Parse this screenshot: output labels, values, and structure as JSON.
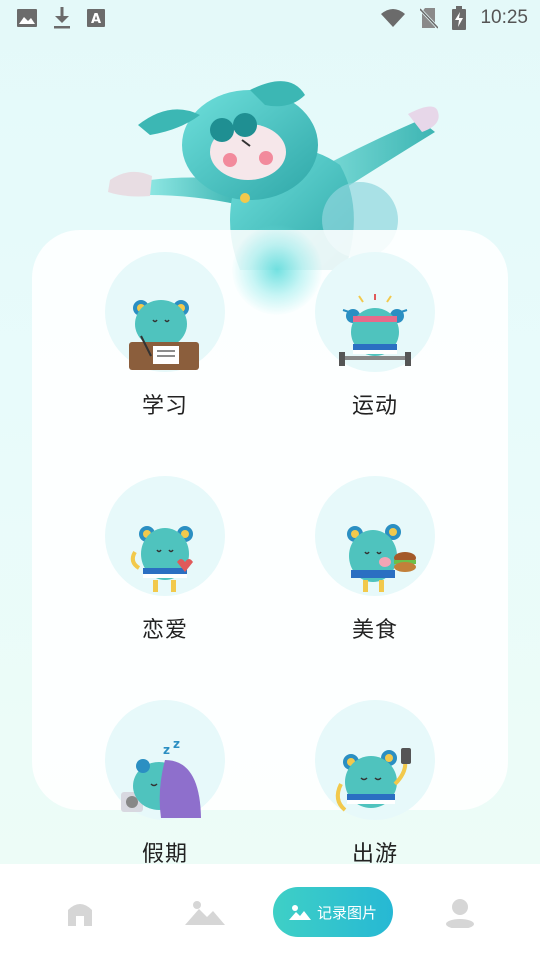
{
  "status_bar": {
    "time": "10:25",
    "icons_left": [
      "image-icon",
      "download-icon",
      "font-icon"
    ],
    "icons_right": [
      "wifi-icon",
      "no-sim-icon",
      "battery-charging-icon"
    ]
  },
  "categories": [
    {
      "label": "学习",
      "icon": "study-mascot-icon"
    },
    {
      "label": "运动",
      "icon": "workout-mascot-icon"
    },
    {
      "label": "恋爱",
      "icon": "love-mascot-icon"
    },
    {
      "label": "美食",
      "icon": "food-mascot-icon"
    },
    {
      "label": "假期",
      "icon": "sleep-mascot-icon"
    },
    {
      "label": "出游",
      "icon": "travel-mascot-icon"
    }
  ],
  "nav": {
    "home_icon": "home-icon",
    "gallery_icon": "mountain-image-icon",
    "record_label": "记录图片",
    "profile_icon": "user-icon"
  },
  "colors": {
    "accent_start": "#3fd0c6",
    "accent_end": "#26b8d4",
    "mascot": "#4fc3be",
    "nav_icon_inactive": "#d6d6d6"
  }
}
